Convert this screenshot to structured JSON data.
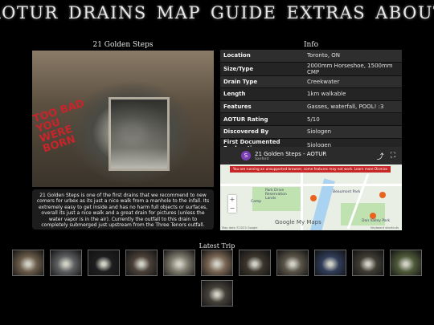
{
  "nav": {
    "items": [
      "AOTUR",
      "DRAINS",
      "MAP",
      "GUIDE",
      "EXTRAS",
      "ABOUT"
    ]
  },
  "drain": {
    "title": "21 Golden Steps",
    "photo_graffiti": "TOO BAD YOU WERE BORN",
    "description": "21 Golden Steps is one of the first drains that we recommend to new comers for urbex as its just a nice walk from a manhole to the infall. Its extremely easy to get inside and has no harm full objects or surfaces, overall its just a nice walk and a great drain for pictures (unless the water vapor is in the air). Currently the outfall to this drain to completely submerged just upstream from the Three Tenors outfall."
  },
  "info": {
    "title": "Info",
    "rows": [
      {
        "key": "Location",
        "value": "Toronto, ON"
      },
      {
        "key": "Size/Type",
        "value": "2000mm Horseshoe, 1500mm CMP"
      },
      {
        "key": "Drain Type",
        "value": "Creekwater"
      },
      {
        "key": "Length",
        "value": "1km walkable"
      },
      {
        "key": "Features",
        "value": "Gasses, waterfall, POOL! :3"
      },
      {
        "key": "AOTUR Rating",
        "value": "5/10"
      },
      {
        "key": "Discovered By",
        "value": "Siologen"
      },
      {
        "key": "First Documented Exploration",
        "value": "Siologen"
      }
    ]
  },
  "map": {
    "avatar_letter": "S",
    "title": "21 Golden Steps - AOTUR",
    "subtitle": "Sanford",
    "warning": "You are running an unsupported browser, some features may not work. Learn more Dismiss",
    "labels": [
      "Park Drive Reservation Lands",
      "Beaumont Park",
      "Don Valley Park",
      "Camp"
    ],
    "google_logo": "Google My Maps",
    "attribution": "Map data ©2023 Google",
    "shortcuts": "Keyboard shortcuts"
  },
  "latest": {
    "title": "Latest Trip",
    "count": 12,
    "colors": [
      "#6b5c4a",
      "#5d5f60",
      "#1e1e20",
      "#4a4038",
      "#7d7a6c",
      "#7a6654",
      "#3b352c",
      "#5a5448",
      "#2f3c58",
      "#3e3b33",
      "#4f5a3a",
      "#444039"
    ]
  },
  "colors": {
    "background": "#000000",
    "panel": "#2e2e2e",
    "graffiti": "#c8242a",
    "warning": "#c62828",
    "pin": "#e8641e"
  }
}
